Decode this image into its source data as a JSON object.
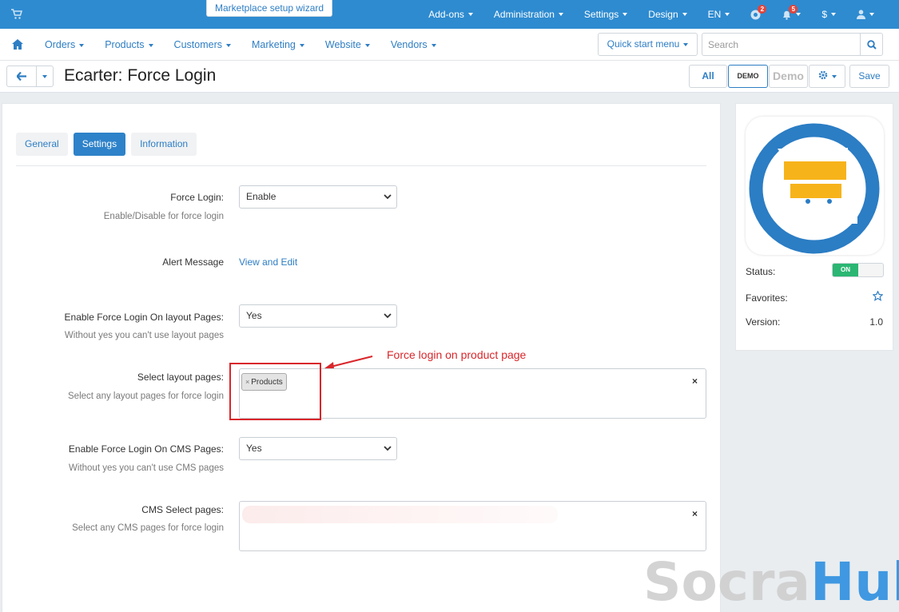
{
  "topbar": {
    "wizard_label": "Marketplace setup wizard",
    "items": [
      {
        "label": "Add-ons"
      },
      {
        "label": "Administration"
      },
      {
        "label": "Settings"
      },
      {
        "label": "Design"
      },
      {
        "label": "EN"
      }
    ],
    "help_badge": "2",
    "notifications_badge": "5",
    "currency": "$"
  },
  "nav": {
    "items": [
      "Orders",
      "Products",
      "Customers",
      "Marketing",
      "Website",
      "Vendors"
    ],
    "quick_start": "Quick start menu",
    "search_placeholder": "Search"
  },
  "titlebar": {
    "title": "Ecarter: Force Login",
    "all_label": "All",
    "demo_label": "DEMO STORE",
    "demo2_label": "Demo Store",
    "save_label": "Save"
  },
  "tabs": [
    {
      "label": "General",
      "active": false
    },
    {
      "label": "Settings",
      "active": true
    },
    {
      "label": "Information",
      "active": false
    }
  ],
  "form": {
    "force_login": {
      "label": "Force Login:",
      "hint": "Enable/Disable for force login",
      "value": "Enable"
    },
    "alert_message": {
      "label": "Alert Message",
      "link": "View and Edit"
    },
    "layout_pages_enable": {
      "label": "Enable Force Login On layout Pages:",
      "hint": "Without yes you can't use layout pages",
      "value": "Yes"
    },
    "layout_pages_select": {
      "label": "Select layout pages:",
      "hint": "Select any layout pages for force login",
      "chip": "Products"
    },
    "cms_pages_enable": {
      "label": "Enable Force Login On CMS Pages:",
      "hint": "Without yes you can't use CMS pages",
      "value": "Yes"
    },
    "cms_pages_select": {
      "label": "CMS Select pages:",
      "hint": "Select any CMS pages for force login"
    }
  },
  "annotation": {
    "text": "Force login on product page",
    "color": "#d9262b"
  },
  "sidebar": {
    "status_label": "Status:",
    "status_value": "ON",
    "favorites_label": "Favorites:",
    "version_label": "Version:",
    "version_value": "1.0"
  },
  "watermark": {
    "part1": "Socra",
    "part2": "Hub"
  },
  "colors": {
    "brand": "#2e8bd0",
    "link": "#2e7ec4",
    "on": "#2bb673",
    "annotation": "#d9262b",
    "logo_orange": "#f7b31a"
  }
}
